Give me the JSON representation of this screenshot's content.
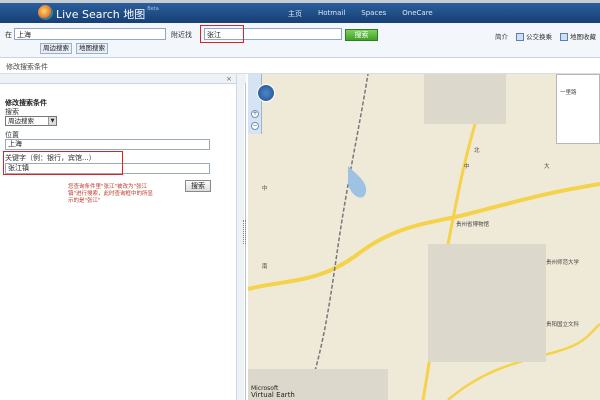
{
  "header": {
    "brand": "Live Search",
    "brand_sub": "地图",
    "brand_tag": "Beta",
    "nav": [
      "主页",
      "Hotmail",
      "Spaces",
      "OneCare"
    ]
  },
  "search": {
    "location_label": "在",
    "location_value": "上海",
    "near_label": "附近找",
    "near_value": "张江",
    "search_button": "搜索",
    "tab_nearby": "周边搜索",
    "tab_map": "地图搜索"
  },
  "tools": {
    "intro": "简介",
    "transit": "公交换乘",
    "favorites": "地图收藏"
  },
  "subbar": {
    "title": "修改搜索条件"
  },
  "panel": {
    "close": "×",
    "title": "修改搜索条件",
    "search_label": "搜索",
    "search_type": "周边搜索",
    "location_label": "位置",
    "location_value": "上海",
    "keyword_label": "关键字（例：银行，宾馆...）",
    "keyword_value": "张江镇",
    "note": "您查询条件里\"张江\"被改为\"张江镇\"进行搜索，此时查询框中的所显示的是\"张江\"",
    "submit": "搜索"
  },
  "map": {
    "labels": [
      "中",
      "南",
      "中",
      "北",
      "大",
      "贵州省博物馆",
      "贵州师范大学",
      "贵阳国立文科",
      "一里路"
    ],
    "credit_line1": "Microsoft",
    "credit_line2": "Virtual Earth"
  },
  "colors": {
    "header_bg": "#1f4a84",
    "search_green": "#3fa12b",
    "highlight_red": "#dd2222",
    "road_yellow": "#f4d24a"
  }
}
